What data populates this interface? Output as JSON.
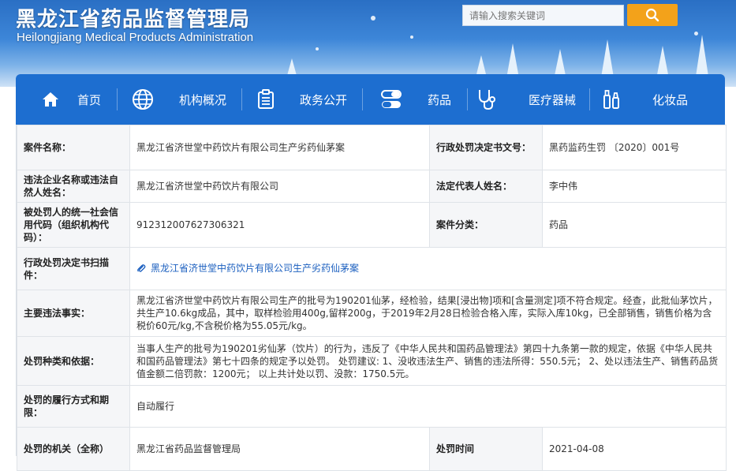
{
  "header": {
    "title": "黑龙江省药品监督管理局",
    "subtitle": "Heilongjiang Medical Products Administration",
    "search_placeholder": "请输入搜索关键词"
  },
  "nav": [
    {
      "label": "首页",
      "icon": "home-icon"
    },
    {
      "label": "机构概况",
      "icon": "globe-icon"
    },
    {
      "label": "政务公开",
      "icon": "clipboard-icon"
    },
    {
      "label": "药品",
      "icon": "capsule-icon"
    },
    {
      "label": "医疗器械",
      "icon": "stethoscope-icon"
    },
    {
      "label": "化妆品",
      "icon": "cosmetics-icon"
    }
  ],
  "case": {
    "name_label": "案件名称：",
    "name": "黑龙江省济世堂中药饮片有限公司生产劣药仙茅案",
    "doc_no_label": "行政处罚决定书文号：",
    "doc_no": "黑药监药生罚 〔2020〕001号",
    "company_label": "违法企业名称或违法自然人姓名：",
    "company": "黑龙江省济世堂中药饮片有限公司",
    "rep_label": "法定代表人姓名：",
    "rep": "李中伟",
    "credit_label": "被处罚人的统一社会信用代码（组织机构代码）：",
    "credit": "912312007627306321",
    "category_label": "案件分类：",
    "category": "药品",
    "scan_label": "行政处罚决定书扫描件：",
    "scan_link": "黑龙江省济世堂中药饮片有限公司生产劣药仙茅案",
    "facts_label": "主要违法事实：",
    "facts": "黑龙江省济世堂中药饮片有限公司生产的批号为190201仙茅，经检验，结果[浸出物]项和[含量测定]项不符合规定。经查，此批仙茅饮片，共生产10.6kg成品，其中，取样检验用400g,留样200g，于2019年2月28日检验合格入库，实际入库10kg，已全部销售，销售价格为含税价60元/kg,不含税价格为55.05元/kg。",
    "basis_label": "处罚种类和依据：",
    "basis": "当事人生产的批号为190201劣仙茅（饮片）的行为，违反了《中华人民共和国药品管理法》第四十九条第一款的规定，依据《中华人民共和国药品管理法》第七十四条的规定予以处罚。 处罚建议: 1、没收违法生产、销售的违法所得：550.5元； 2、处以违法生产、销售药品货值金额二倍罚款：1200元； 以上共计处以罚、没款：1750.5元。",
    "method_label": "处罚的履行方式和期限：",
    "method": "自动履行",
    "authority_label": "处罚的机关（全称）",
    "authority": "黑龙江省药品监督管理局",
    "time_label": "处罚时间",
    "time": "2021-04-08"
  },
  "colors": {
    "nav_bg": "#1d6ed0",
    "search_button": "#f3a21a",
    "link": "#1b5fbf",
    "label_bg": "#f5f6f8"
  }
}
